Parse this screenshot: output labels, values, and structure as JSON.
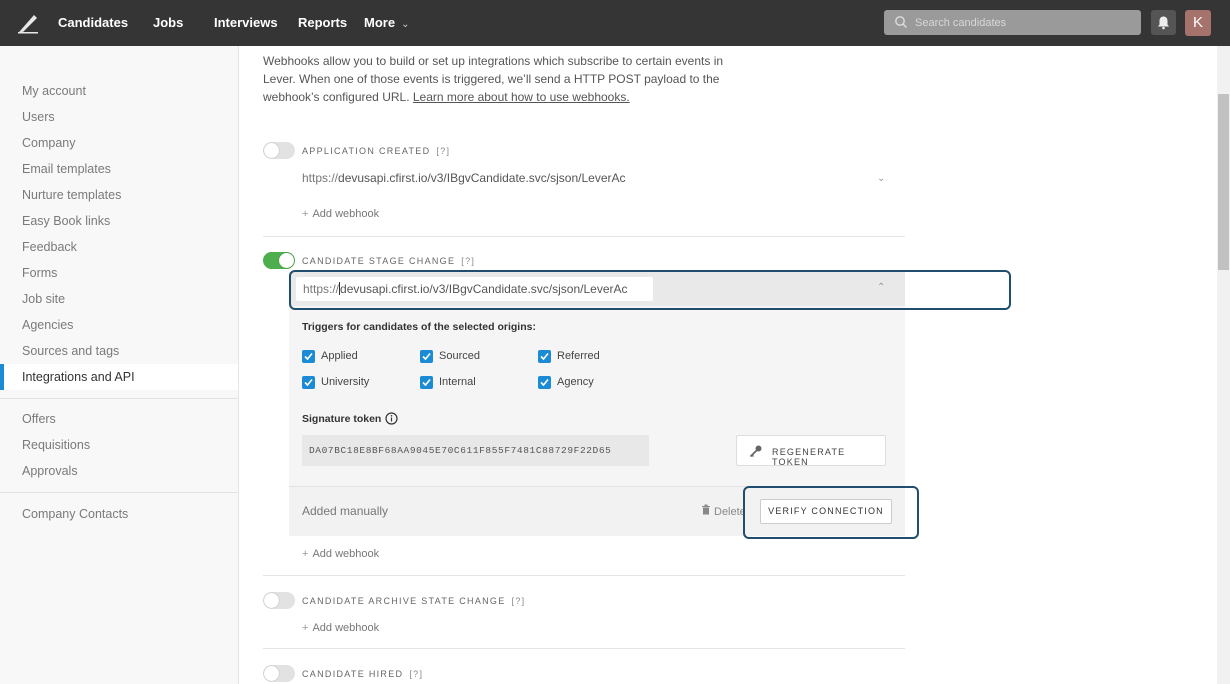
{
  "topnav": {
    "items": [
      "Candidates",
      "Jobs",
      "Interviews",
      "Reports",
      "More"
    ],
    "search_placeholder": "Search candidates",
    "avatar_initial": "K"
  },
  "sidebar": {
    "group1": [
      "My account",
      "Users",
      "Company",
      "Email templates",
      "Nurture templates",
      "Easy Book links",
      "Feedback",
      "Forms",
      "Job site",
      "Agencies",
      "Sources and tags",
      "Integrations and API"
    ],
    "group2": [
      "Offers",
      "Requisitions",
      "Approvals"
    ],
    "group3": [
      "Company Contacts"
    ],
    "active": "Integrations and API"
  },
  "intro": {
    "text": "Webhooks allow you to build or set up integrations which subscribe to certain events in Lever. When one of those events is triggered, we’ll send a HTTP POST payload to the webhook’s configured URL. ",
    "link": "Learn more about how to use webhooks."
  },
  "sections": {
    "application_created": {
      "title": "APPLICATION CREATED",
      "help": "[?]",
      "enabled": false,
      "url_prefix": "https://",
      "url": "devusapi.cfirst.io/v3/IBgvCandidate.svc/sjson/LeverAc",
      "add_webhook": "Add webhook"
    },
    "candidate_stage_change": {
      "title": "CANDIDATE STAGE CHANGE",
      "help": "[?]",
      "enabled": true,
      "url_prefix": "https://",
      "url": "devusapi.cfirst.io/v3/IBgvCandidate.svc/sjson/LeverAc",
      "triggers_title": "Triggers for candidates of the selected origins:",
      "triggers": [
        {
          "label": "Applied",
          "checked": true
        },
        {
          "label": "Sourced",
          "checked": true
        },
        {
          "label": "Referred",
          "checked": true
        },
        {
          "label": "University",
          "checked": true
        },
        {
          "label": "Internal",
          "checked": true
        },
        {
          "label": "Agency",
          "checked": true
        }
      ],
      "signature_title": "Signature token",
      "token": "DA07BC18E8BF68AA9045E70C611F855F7481C88729F22D65",
      "regenerate_label": "REGENERATE TOKEN",
      "added_label": "Added manually",
      "delete_label": "Delete",
      "verify_label": "VERIFY CONNECTION",
      "add_webhook": "Add webhook"
    },
    "candidate_archive_state_change": {
      "title": "CANDIDATE ARCHIVE STATE CHANGE",
      "help": "[?]",
      "enabled": false,
      "add_webhook": "Add webhook"
    },
    "candidate_hired": {
      "title": "CANDIDATE HIRED",
      "help": "[?]",
      "enabled": false
    }
  },
  "colors": {
    "topnav_bg": "#353535",
    "accent": "#1a8bd4",
    "toggle_on": "#4cae4c",
    "highlight_border": "#1f4e6e"
  }
}
